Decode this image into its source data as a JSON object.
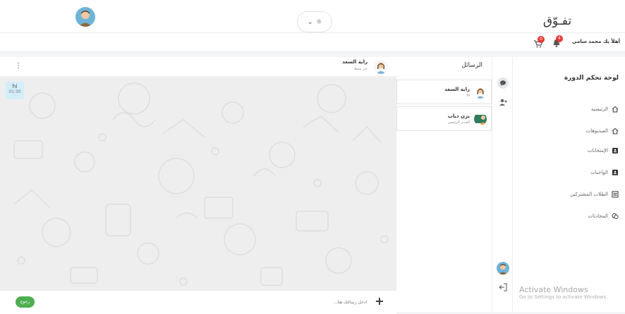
{
  "header": {
    "logo_text": "تفـوّق",
    "theme_toggle": {
      "icon": "sun-icon",
      "caret": "chevron-down-icon"
    },
    "user_avatar_icon": "avatar-icon"
  },
  "userbar": {
    "greeting": "أهلاً بك محمد سامي",
    "notifications_count": "4",
    "cart_count": "0"
  },
  "sidebar": {
    "title": "لوحة تحكم الدورة",
    "items": [
      {
        "label": "الرئيسية",
        "icon": "home-icon"
      },
      {
        "label": "الفيديوهات",
        "icon": "home-icon"
      },
      {
        "label": "الإمتحانات",
        "icon": "id-card-icon"
      },
      {
        "label": "الواجبات",
        "icon": "id-card-icon"
      },
      {
        "label": "الطلاب المشتركين",
        "icon": "list-icon"
      },
      {
        "label": "المحادثات",
        "icon": "chat-icon"
      }
    ]
  },
  "conversations": {
    "title": "الرسائل",
    "items": [
      {
        "name": "راية السعد",
        "subtitle": "hi"
      },
      {
        "name": "يزن دياب",
        "subtitle": "المدير الرئيسي"
      }
    ]
  },
  "chat": {
    "contact_name": "راية السعد",
    "contact_status": "غير نشط",
    "messages": [
      {
        "text": "hi",
        "time": "01:30"
      }
    ],
    "input_placeholder": "ادخل رسالتك هنا...",
    "back_label": "رجوع",
    "add_label": "+"
  },
  "os_watermark": {
    "title": "Activate Windows",
    "subtitle": "Go to Settings to activate Windows."
  },
  "colors": {
    "accent_green": "#4caf50",
    "badge_red": "#e53935",
    "message_bubble": "#d3eef9",
    "chat_background": "#eeeeee"
  }
}
